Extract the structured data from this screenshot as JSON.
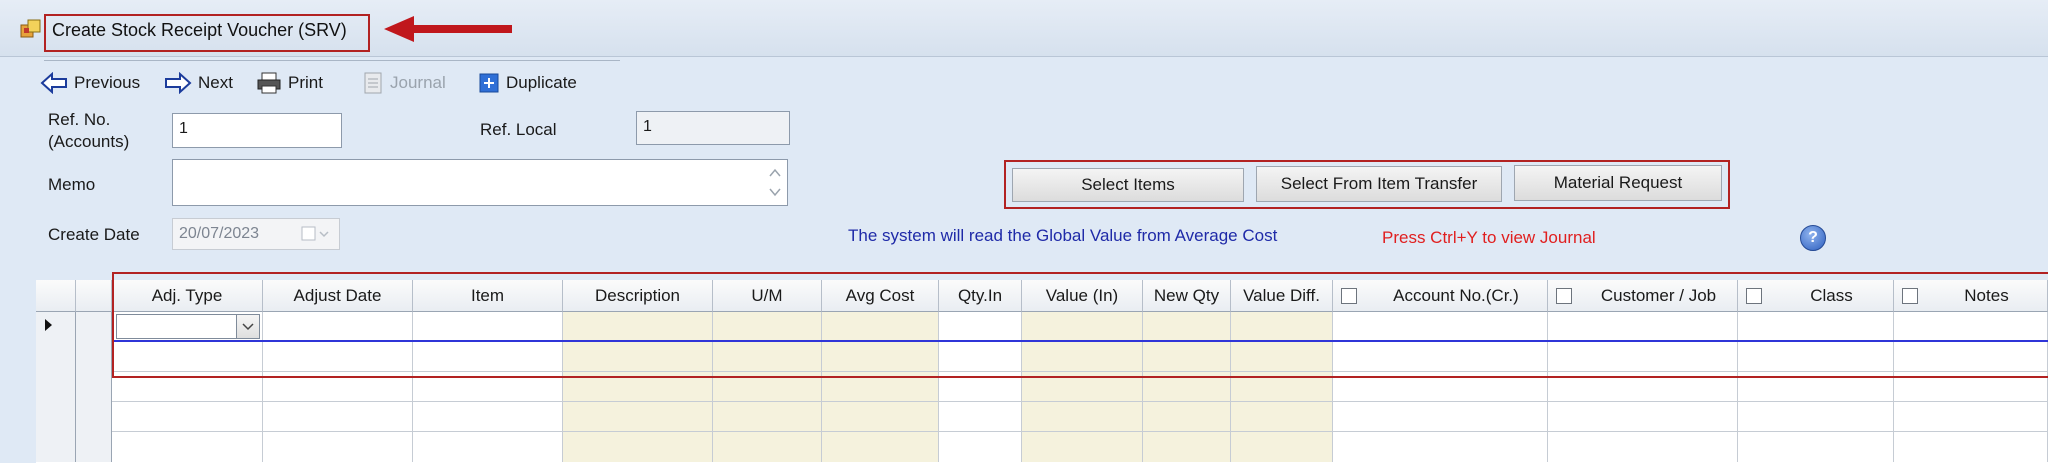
{
  "window": {
    "title": "Create Stock Receipt Voucher (SRV)"
  },
  "toolbar": {
    "previous": "Previous",
    "next": "Next",
    "print": "Print",
    "journal": "Journal",
    "duplicate": "Duplicate"
  },
  "form": {
    "ref_no_label_1": "Ref. No.",
    "ref_no_label_2": "(Accounts)",
    "ref_no_value": "1",
    "ref_local_label": "Ref. Local",
    "ref_local_value": "1",
    "memo_label": "Memo",
    "memo_value": "",
    "create_date_label": "Create Date",
    "create_date_value": "20/07/2023"
  },
  "actions": {
    "select_items": "Select Items",
    "select_from_transfer": "Select From Item Transfer",
    "material_request": "Material Request"
  },
  "messages": {
    "global_value": "The system will read the Global Value from Average Cost",
    "press_ctrl_y": "Press Ctrl+Y to view Journal"
  },
  "grid": {
    "columns": [
      "Adj. Type",
      "Adjust Date",
      "Item",
      "Description",
      "U/M",
      "Avg Cost",
      "Qty.In",
      "Value (In)",
      "New Qty",
      "Value Diff.",
      "Account No.(Cr.)",
      "Customer / Job",
      "Class",
      "Notes"
    ]
  },
  "icons": [
    "app-window-icon",
    "arrow-left-icon",
    "arrow-right-icon",
    "printer-icon",
    "journal-icon",
    "duplicate-icon",
    "help-icon",
    "calendar-icon",
    "chevron-down-icon"
  ],
  "colors": {
    "annotation_red": "#b22222",
    "message_blue": "#1f2aa8",
    "message_red": "#e01f1f",
    "tan_column": "#f5f2dd"
  }
}
